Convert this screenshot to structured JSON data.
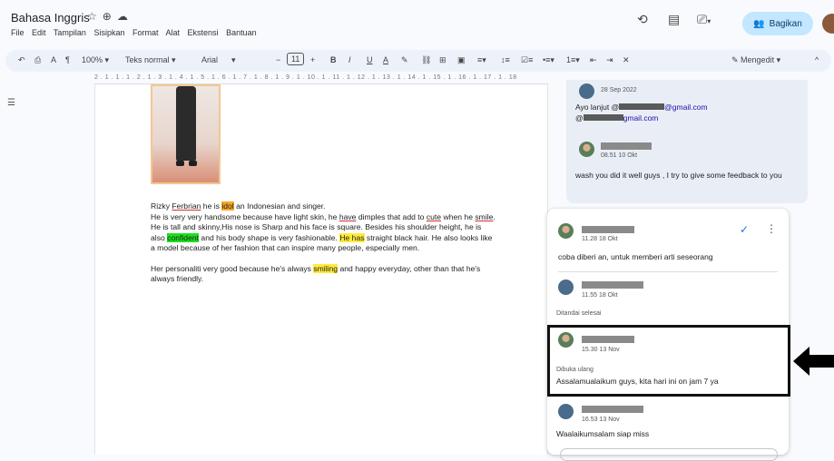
{
  "header": {
    "doc_title": "Bahasa Inggris",
    "menu": [
      "File",
      "Edit",
      "Tampilan",
      "Sisipkan",
      "Format",
      "Alat",
      "Ekstensi",
      "Bantuan"
    ],
    "share_label": "Bagikan",
    "icons": [
      "star-icon",
      "move-icon",
      "cloud-icon",
      "history-icon",
      "comment-icon",
      "meet-icon"
    ]
  },
  "toolbar": {
    "zoom": "100%",
    "style": "Teks normal",
    "font": "Arial",
    "font_size": "11",
    "mode": "Mengedit"
  },
  "ruler": "2 . 1 . 1 . 1 . 2 . 1 . 3 . 1 . 4 . 1 . 5 . 1 . 6 . 1 . 7 . 1 . 8 . 1 . 9 . 1 . 10 . 1 . 11 . 1 . 12 . 1 . 13 . 1 . 14 . 1 . 15 . 1 . 16 . 1 . 17 . 1 . 18",
  "document": {
    "p1": {
      "a": "Rizky ",
      "b": "Ferbrian",
      "c": " he is ",
      "d": "idol",
      "e": " an Indonesian and singer."
    },
    "p2": {
      "a": "He is very very handsome because have ",
      "b": "light skin, he ",
      "c": "have",
      "d": " dimples that add to ",
      "e": "cute",
      "f": " when he ",
      "g": "smile",
      "h": ". He is tall and skinny,His nose is Sharp and his face is square. Besides ",
      "i": "his shoulder height, he is also ",
      "j": "confident",
      "k": " and his body shape is very fashionable. ",
      "l": "He has",
      "m": " straight black hair. He also looks like a model because of her fashion that can inspire many people, especially men."
    },
    "p3": {
      "a": "Her personaliti very good because he's always ",
      "b": "smiling",
      "c": " and happy everyday, other than that he's always friendly."
    }
  },
  "comments_old": {
    "date1": "28 Sep 2022",
    "text1_prefix": "Ayo lanjut @",
    "text1_suffix": "@gmail.com",
    "text1_line2": "@",
    "text1_line2_suffix": "gmail.com",
    "time2": "08.51 10 Okt",
    "text2": "wash you did it well guys , I try to give some feedback to you"
  },
  "thread": {
    "c1_time": "11.28 18 Okt",
    "c1_text": "coba diberi an, untuk memberi arti seseorang",
    "c2_time": "11.55 18 Okt",
    "c2_status": "Ditandai selesai",
    "c3_time": "15.30 13 Nov",
    "c3_status": "Dibuka ulang",
    "c3_text": "Assalamualaikum guys, kita hari ini on jam 7 ya",
    "c4_time": "16.53 13 Nov",
    "c4_text": "Waalaikumsalam siap miss"
  }
}
